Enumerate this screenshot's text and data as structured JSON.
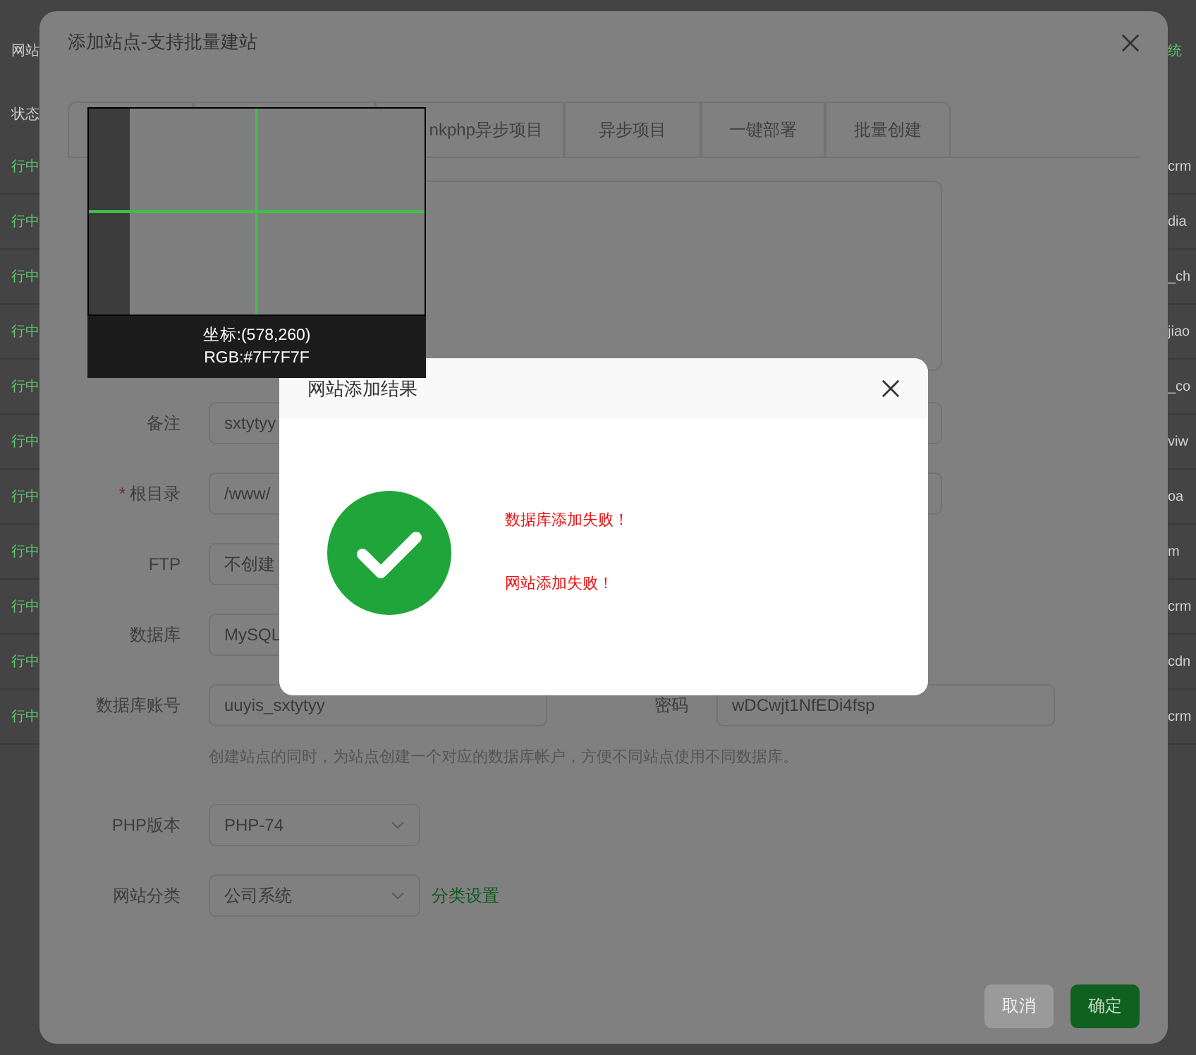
{
  "background_page": {
    "header_left": "网站",
    "header_right": "统",
    "status_header": "状态",
    "rows": [
      {
        "status": "行中",
        "name": "crm"
      },
      {
        "status": "行中",
        "name": "dia"
      },
      {
        "status": "行中",
        "name": "_ch"
      },
      {
        "status": "行中",
        "name": "jiao"
      },
      {
        "status": "行中",
        "name": "_co"
      },
      {
        "status": "行中",
        "name": "viw"
      },
      {
        "status": "行中",
        "name": "oa"
      },
      {
        "status": "行中",
        "name": "m"
      },
      {
        "status": "行中",
        "name": "crm"
      },
      {
        "status": "行中",
        "name": "cdn"
      },
      {
        "status": "行中",
        "name": "crm"
      }
    ]
  },
  "dialog": {
    "title": "添加站点-支持批量建站",
    "tabs": [
      {
        "label": "nkphp异步项目",
        "selected": false
      },
      {
        "label": "异步项目",
        "selected": false
      },
      {
        "label": "一键部署",
        "selected": false
      },
      {
        "label": "批量创建",
        "selected": false
      }
    ],
    "remark": {
      "label": "备注",
      "value": "sxtytyy"
    },
    "root_dir": {
      "label": "根目录",
      "required_mark": "*",
      "value": "/www/"
    },
    "ftp": {
      "label": "FTP",
      "value": "不创建"
    },
    "database": {
      "label": "数据库",
      "value": "MySQL"
    },
    "db_account": {
      "label": "数据库账号",
      "value": "uuyis_sxtytyy",
      "password_label": "密码",
      "password": "wDCwjt1NfEDi4fsp",
      "hint": "创建站点的同时，为站点创建一个对应的数据库帐户，方便不同站点使用不同数据库。"
    },
    "php_version": {
      "label": "PHP版本",
      "value": "PHP-74"
    },
    "site_category": {
      "label": "网站分类",
      "value": "公司系统",
      "link": "分类设置"
    },
    "buttons": [
      {
        "label": "取消",
        "kind": "cancel"
      },
      {
        "label": "确定",
        "kind": "confirm"
      }
    ]
  },
  "color_picker": {
    "coordinates": "坐标:(578,260)",
    "rgb": "RGB:#7F7F7F"
  },
  "result_dialog": {
    "title": "网站添加结果",
    "kind": "success",
    "messages": [
      "数据库添加失败！",
      "网站添加失败！"
    ]
  }
}
